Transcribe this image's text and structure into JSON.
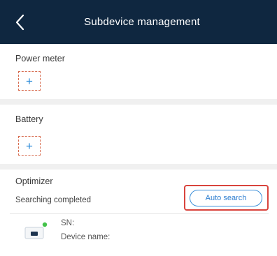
{
  "header": {
    "title": "Subdevice management",
    "background": "#0f2740"
  },
  "sections": {
    "power_meter": {
      "label": "Power meter",
      "add_symbol": "+"
    },
    "battery": {
      "label": "Battery",
      "add_symbol": "+"
    },
    "optimizer": {
      "label": "Optimizer",
      "status": "Searching completed",
      "button": "Auto search"
    }
  },
  "device": {
    "sn_label": "SN:",
    "name_label": "Device name:"
  },
  "colors": {
    "accent": "#2f7fd0",
    "highlight": "#d9443d",
    "status_online": "#43c24a"
  }
}
